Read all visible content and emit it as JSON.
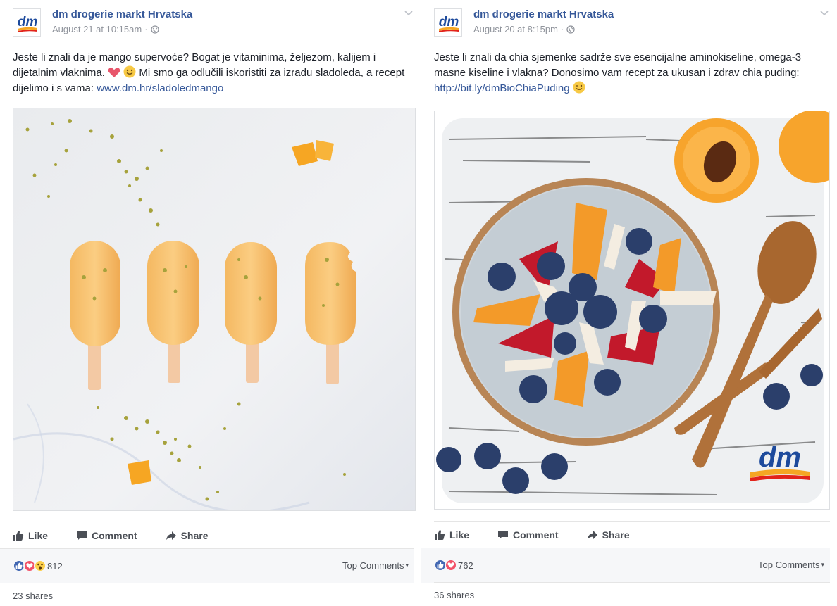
{
  "posts": [
    {
      "page_name": "dm drogerie markt Hrvatska",
      "timestamp": "August 21 at 10:15am",
      "text_main": "Jeste li znali da je mango supervoće? Bogat je vitaminima, željezom, kalijem i dijetalnim vlaknima.",
      "text_after_emoji": "Mi smo ga odlučili iskoristiti za izradu sladoleda, a recept dijelimo i s vama:",
      "link": "www.dm.hr/sladoledmango",
      "actions": {
        "like": "Like",
        "comment": "Comment",
        "share": "Share"
      },
      "reaction_count": "812",
      "reactions": [
        "like-icon",
        "love-icon",
        "wow-icon"
      ],
      "top_comments": "Top Comments",
      "shares": "23 shares"
    },
    {
      "page_name": "dm drogerie markt Hrvatska",
      "timestamp": "August 20 at 8:15pm",
      "text_main": "Jeste li znali da chia sjemenke sadrže sve esencijalne aminokiseline, omega-3 masne kiseline i vlakna? Donosimo vam recept za ukusan i zdrav chia puding:",
      "link": "http://bit.ly/dmBioChiaPuding",
      "actions": {
        "like": "Like",
        "comment": "Comment",
        "share": "Share"
      },
      "reaction_count": "762",
      "reactions": [
        "like-icon",
        "love-icon"
      ],
      "top_comments": "Top Comments",
      "shares": "36 shares"
    }
  ],
  "logo_text": "dm",
  "colors": {
    "link": "#365899",
    "like_blue": "#4267b2",
    "love_red": "#f25268",
    "wow_yellow": "#fdd04b",
    "dm_blue": "#1d4a9c",
    "dm_orange": "#f5a623",
    "dm_red": "#e2231a"
  }
}
